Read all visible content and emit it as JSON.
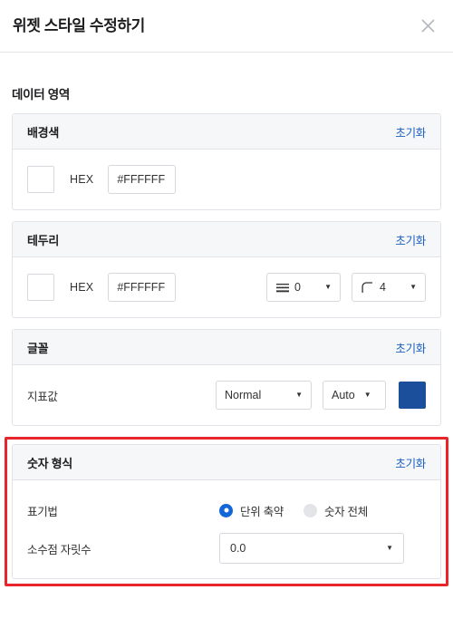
{
  "dialog": {
    "title": "위젯 스타일 수정하기",
    "close_icon": "close-icon"
  },
  "section": {
    "title": "데이터 영역"
  },
  "colors": {
    "accent_link": "#1a5fc0",
    "radio_selected": "#1167d8",
    "radio_unselected": "#e3e4e8",
    "font_color_swatch": "#1b4f9c",
    "highlight_border": "#e8252a",
    "card_header_bg": "#f6f7f9",
    "card_border": "#e1e3e8"
  },
  "cards": {
    "background": {
      "title": "배경색",
      "reset_label": "초기화",
      "swatch_color": "#ffffff",
      "hex_label": "HEX",
      "hex_value": "#FFFFFF",
      "hex_placeholder": "#FFFFFF"
    },
    "border": {
      "title": "테두리",
      "reset_label": "초기화",
      "swatch_color": "#ffffff",
      "hex_label": "HEX",
      "hex_value": "#FFFFFF",
      "hex_placeholder": "#FFFFFF",
      "stroke_width_value": "0",
      "corner_radius_value": "4"
    },
    "font": {
      "title": "글꼴",
      "reset_label": "초기화",
      "row_label": "지표값",
      "weight_value": "Normal",
      "size_value": "Auto",
      "color_value": "#1b4f9c"
    },
    "number_format": {
      "title": "숫자 형식",
      "reset_label": "초기화",
      "notation_label": "표기법",
      "notation_options": [
        {
          "label": "단위 축약",
          "selected": true
        },
        {
          "label": "숫자 전체",
          "selected": false
        }
      ],
      "decimal_label": "소수점 자릿수",
      "decimal_value": "0.0"
    }
  }
}
